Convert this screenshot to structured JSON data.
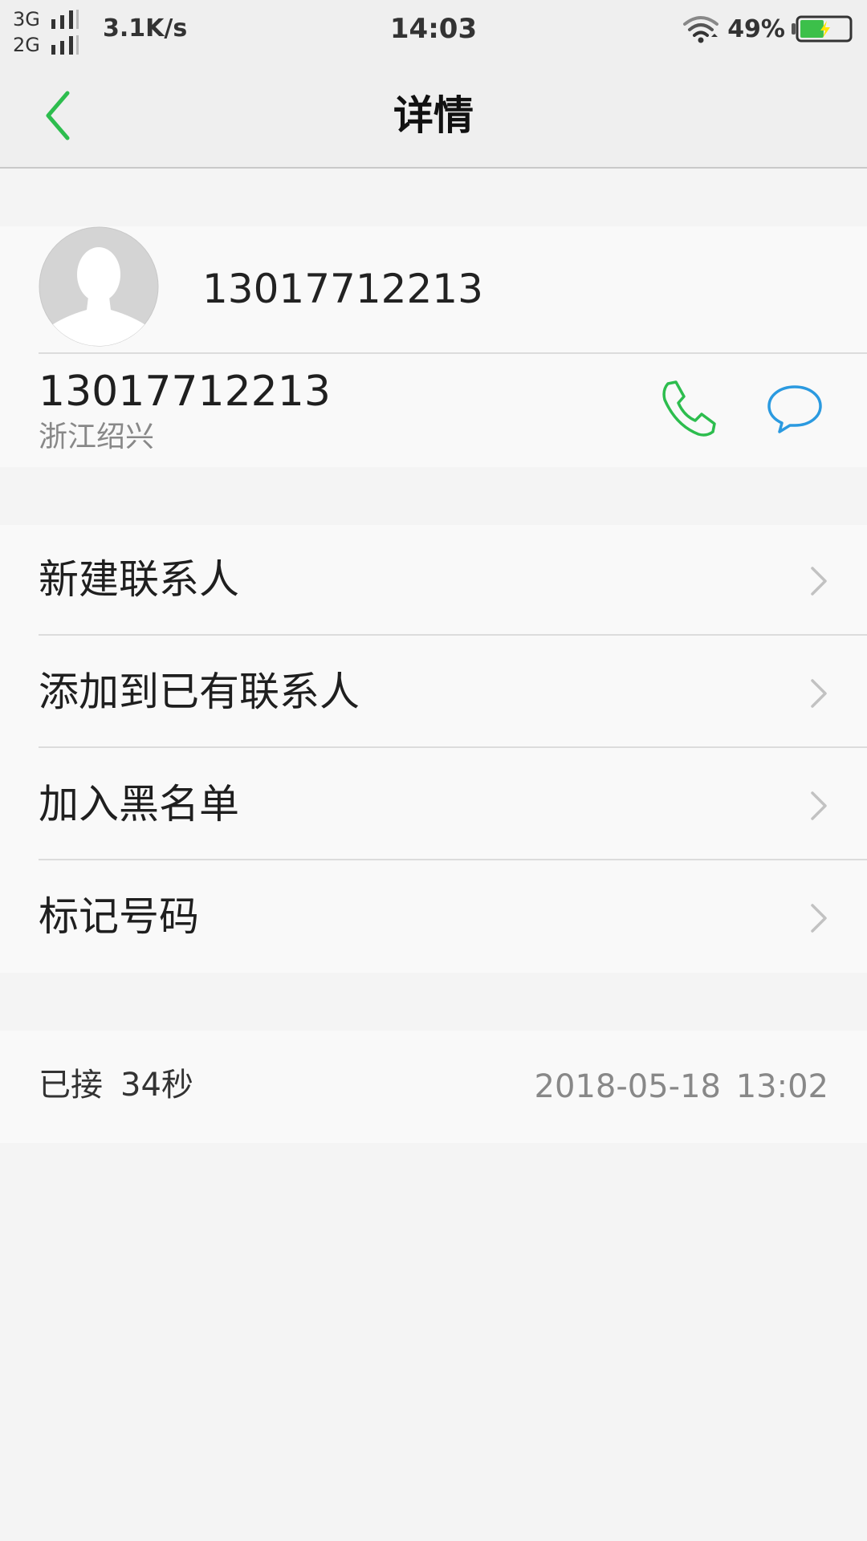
{
  "status_bar": {
    "net_row1": "3G",
    "net_row2": "2G",
    "speed": "3.1K/s",
    "time": "14:03",
    "battery_percent": "49%",
    "icons": [
      "signal-icon",
      "wifi-icon",
      "battery-charging-icon"
    ],
    "battery_level": 0.49
  },
  "header": {
    "title": "详情",
    "back_icon": "chevron-left-icon"
  },
  "contact": {
    "display_name": "13017712213",
    "number": "13017712213",
    "location": "浙江绍兴",
    "avatar_icon": "default-avatar-icon",
    "call_icon": "phone-icon",
    "message_icon": "message-bubble-icon"
  },
  "menu": {
    "items": [
      {
        "label": "新建联系人"
      },
      {
        "label": "添加到已有联系人"
      },
      {
        "label": "加入黑名单"
      },
      {
        "label": "标记号码"
      }
    ],
    "chevron_icon": "chevron-right-icon"
  },
  "call_log": {
    "status": "已接",
    "duration": "34秒",
    "datetime": "2018-05-18  13:02"
  },
  "colors": {
    "accent_green": "#2dbd4e",
    "message_blue": "#2b9ae0",
    "background": "#f4f4f4",
    "card": "#f9f9f9"
  }
}
